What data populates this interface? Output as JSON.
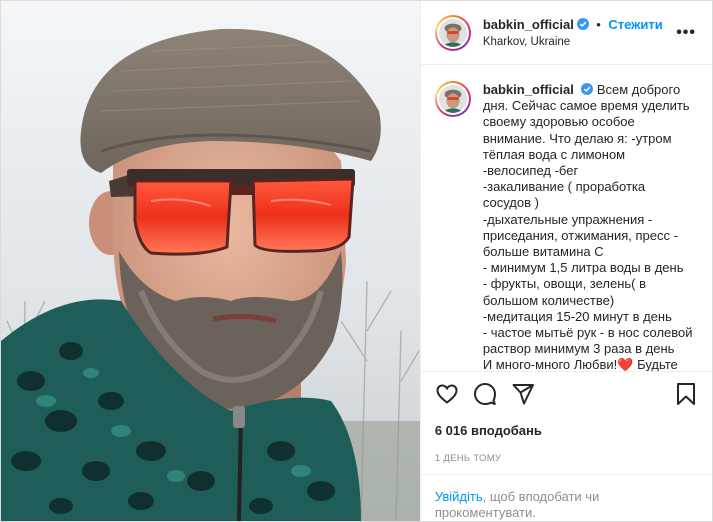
{
  "post": {
    "author": {
      "username": "babkin_official",
      "verified_icon": "verified-badge-icon",
      "follow_label": "Стежити",
      "location": "Kharkov, Ukraine"
    },
    "caption": {
      "username": "babkin_official",
      "text": "Всем доброго дня. Сейчас самое время уделить своему здоровью особое внимание. Что делаю я: -утром тёплая вода с лимоном -велосипед -бег\n-закаливание ( проработка сосудов )\n-дыхательные упражнения - приседания, отжимания, пресс - больше витамина С\n- минимум 1,5 литра воды в день\n- фрукты, овощи, зелень( в большом количестве)\n-медитация 15-20 минут в день\n- частое мытьё рук - в нос солевой раствор минимум 3 раза в день\nИ много-много Любви!",
      "heart": "❤️",
      "text_end": " Будьте здоровенькими! ",
      "muscle": "💪🏻"
    },
    "likes": "6 016 вподобань",
    "time_ago": "1 день тому",
    "login_link": "Увійдіть",
    "login_text": ", щоб вподобати чи прокоментувати.",
    "icons": {
      "like": "heart-outline-icon",
      "comment": "comment-bubble-icon",
      "share": "paper-plane-icon",
      "save": "bookmark-icon",
      "more": "more-options-icon"
    },
    "colors": {
      "link": "#0095f6",
      "text": "#262626",
      "muted": "#8e8e8e",
      "border": "#efefef",
      "heart": "#ed4956"
    }
  }
}
